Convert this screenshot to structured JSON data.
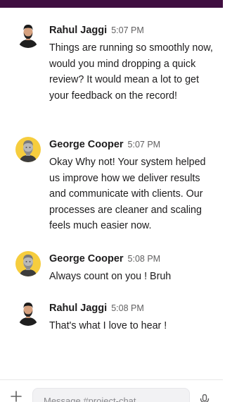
{
  "channel": {
    "placeholder": "Message #project-chat"
  },
  "messages": [
    {
      "author": "Rahul Jaggi",
      "time": "5:07 PM",
      "avatar": "avatar-rahul",
      "text": "Things are running so smoothly now, would you mind dropping a quick review? It would mean a lot to get your feedback on the record!"
    },
    {
      "author": "George Cooper",
      "time": "5:07 PM",
      "avatar": "avatar-george",
      "text": "Okay Why not! Your system helped us improve how we deliver results and communicate with clients. Our processes are cleaner and scaling feels much easier now."
    },
    {
      "author": "George Cooper",
      "time": "5:08 PM",
      "avatar": "avatar-george",
      "text": "Always count on you ! Bruh"
    },
    {
      "author": "Rahul Jaggi",
      "time": "5:08 PM",
      "avatar": "avatar-rahul",
      "text": "That's what I love to hear !"
    }
  ],
  "colors": {
    "topbar": "#3f0e40",
    "avatar_george_bg": "#f6cd3e"
  }
}
